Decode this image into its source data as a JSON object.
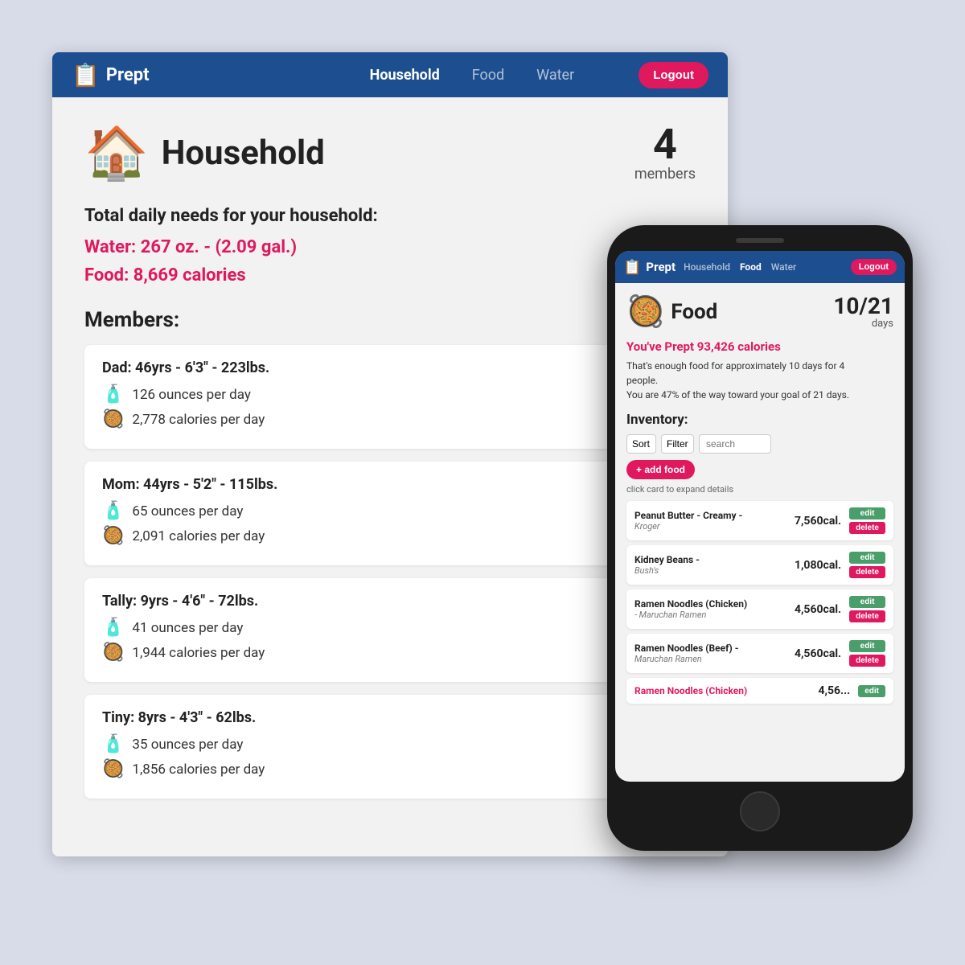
{
  "app": {
    "name": "Prept",
    "logo_icon": "📋"
  },
  "desktop": {
    "nav": {
      "household_label": "Household",
      "food_label": "Food",
      "water_label": "Water",
      "logout_label": "Logout"
    },
    "household": {
      "icon": "🏠",
      "title": "Household",
      "members_count": "4",
      "members_label": "members",
      "daily_needs_title": "Total daily needs for your household:",
      "water_need": "Water: 267 oz. - (2.09 gal.)",
      "food_need": "Food: 8,669 calories",
      "members_section_title": "Members:",
      "members": [
        {
          "name_age": "Dad: 46yrs - 6'3\" - 223lbs.",
          "water_icon": "🧴",
          "water": "126 ounces per day",
          "food_icon": "🥘",
          "food": "2,778 calories per day"
        },
        {
          "name_age": "Mom: 44yrs - 5'2\" - 115lbs.",
          "water_icon": "🧴",
          "water": "65 ounces per day",
          "food_icon": "🥘",
          "food": "2,091 calories per day"
        },
        {
          "name_age": "Tally: 9yrs - 4'6\" - 72lbs.",
          "water_icon": "🧴",
          "water": "41 ounces per day",
          "food_icon": "🥘",
          "food": "1,944 calories per day"
        },
        {
          "name_age": "Tiny: 8yrs - 4'3\" - 62lbs.",
          "water_icon": "🧴",
          "water": "35 ounces per day",
          "food_icon": "🥘",
          "food": "1,856 calories per day"
        }
      ]
    }
  },
  "phone": {
    "nav": {
      "household_label": "Household",
      "food_label": "Food",
      "water_label": "Water",
      "logout_label": "Logout"
    },
    "food": {
      "icon": "🥘",
      "title": "Food",
      "days_num": "10/21",
      "days_label": "days",
      "prept_cal": "You've Prept 93,426 calories",
      "desc_line1": "That's enough food for approximately 10 days for 4",
      "desc_line2": "people.",
      "desc_line3": "You are 47% of the way toward your goal of 21 days.",
      "inventory_title": "Inventory:",
      "sort_label": "Sort",
      "filter_label": "Filter",
      "search_placeholder": "search",
      "add_food_label": "+ add food",
      "click_hint": "click card to expand details",
      "items": [
        {
          "name": "Peanut Butter - Creamy -",
          "brand": "Kroger",
          "cal": "7,560cal."
        },
        {
          "name": "Kidney Beans -",
          "brand": "Bush's",
          "cal": "1,080cal."
        },
        {
          "name": "Ramen Noodles (Chicken)",
          "brand": "- Maruchan Ramen",
          "cal": "4,560cal."
        },
        {
          "name": "Ramen Noodles (Beef) -",
          "brand": "Maruchan Ramen",
          "cal": "4,560cal."
        },
        {
          "name": "Ramen Noodles (Chicken)",
          "brand": "",
          "cal": "4,56..."
        }
      ]
    }
  }
}
